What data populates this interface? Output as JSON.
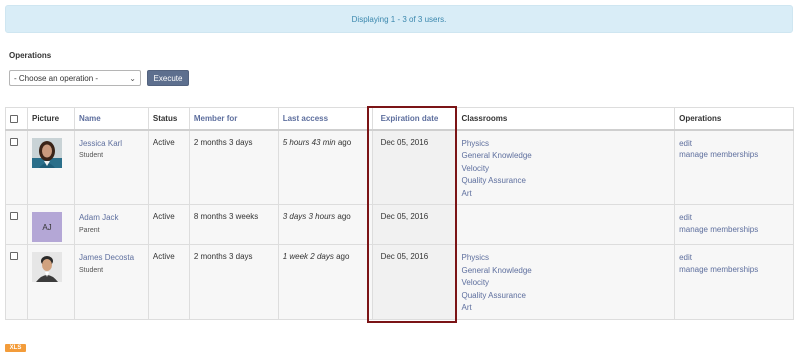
{
  "banner": {
    "text": "Displaying 1 - 3 of 3 users."
  },
  "operations": {
    "label": "Operations",
    "selected": "- Choose an operation -",
    "execute_label": "Execute"
  },
  "table": {
    "headers": {
      "picture": "Picture",
      "name": "Name",
      "status": "Status",
      "member_for": "Member for",
      "last_access": "Last access",
      "expiration_date": "Expiration date",
      "classrooms": "Classrooms",
      "operations": "Operations"
    },
    "rows": [
      {
        "name": "Jessica Karl",
        "role": "Student",
        "status": "Active",
        "member_for": "2 months 3 days",
        "last_access_italic": "5 hours 43 min",
        "last_access_suffix": " ago",
        "expiration": "Dec 05, 2016",
        "classrooms": [
          "Physics",
          "General Knowledge",
          "Velocity",
          "Quality Assurance",
          "Art"
        ],
        "ops": [
          "edit",
          "manage memberships"
        ]
      },
      {
        "name": "Adam Jack",
        "role": "Parent",
        "avatar_initials": "AJ",
        "status": "Active",
        "member_for": "8 months 3 weeks",
        "last_access_italic": "3 days 3 hours",
        "last_access_suffix": " ago",
        "expiration": "Dec 05, 2016",
        "classrooms": [],
        "ops": [
          "edit",
          "manage memberships"
        ]
      },
      {
        "name": "James Decosta",
        "role": "Student",
        "status": "Active",
        "member_for": "2 months 3 days",
        "last_access_italic": "1 week 2 days",
        "last_access_suffix": " ago",
        "expiration": "Dec 05, 2016",
        "classrooms": [
          "Physics",
          "General Knowledge",
          "Velocity",
          "Quality Assurance",
          "Art"
        ],
        "ops": [
          "edit",
          "manage memberships"
        ]
      }
    ]
  },
  "export": {
    "xls_label": "XLS"
  },
  "colors": {
    "banner_bg": "#d9edf7",
    "banner_text": "#3a87ad",
    "link": "#5e6f9e",
    "highlight": "#7b1416",
    "xls": "#f39c3a"
  }
}
